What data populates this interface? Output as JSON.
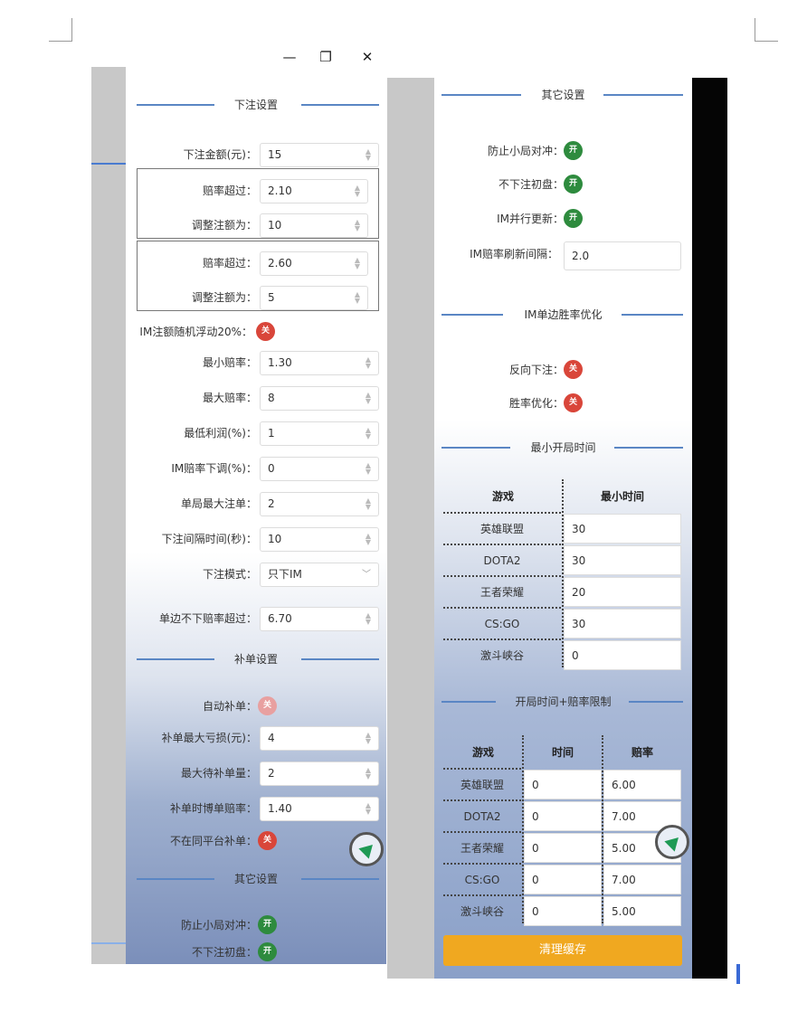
{
  "window_controls": {
    "minimize": "—",
    "restore": "❐",
    "close": "✕"
  },
  "left": {
    "bet_settings": {
      "title": "下注设置",
      "bet_amount": {
        "label": "下注金额(元)：",
        "value": "15"
      },
      "rule1": {
        "odds_label": "赔率超过：",
        "odds_value": "2.10",
        "adjust_label": "调整注额为：",
        "adjust_value": "10"
      },
      "rule2": {
        "odds_label": "赔率超过：",
        "odds_value": "2.60",
        "adjust_label": "调整注额为：",
        "adjust_value": "5"
      },
      "im_random": {
        "label": "IM注额随机浮动20%：",
        "toggle": "关"
      },
      "min_odds": {
        "label": "最小赔率：",
        "value": "1.30"
      },
      "max_odds": {
        "label": "最大赔率：",
        "value": "8"
      },
      "min_profit": {
        "label": "最低利润(%)：",
        "value": "1"
      },
      "im_odds_down": {
        "label": "IM赔率下调(%)：",
        "value": "0"
      },
      "max_per_game": {
        "label": "单局最大注单：",
        "value": "2"
      },
      "bet_interval": {
        "label": "下注间隔时间(秒)：",
        "value": "10"
      },
      "bet_mode": {
        "label": "下注模式：",
        "value": "只下IM"
      },
      "one_side_limit": {
        "label": "单边不下赔率超过：",
        "value": "6.70"
      }
    },
    "supplement": {
      "title": "补单设置",
      "auto": {
        "label": "自动补单：",
        "toggle": "关"
      },
      "max_loss": {
        "label": "补单最大亏损(元)：",
        "value": "4"
      },
      "max_pending": {
        "label": "最大待补单量：",
        "value": "2"
      },
      "bet_odds": {
        "label": "补单时博单赔率：",
        "value": "1.40"
      },
      "not_same_platform": {
        "label": "不在同平台补单：",
        "toggle": "关"
      }
    },
    "other": {
      "title": "其它设置",
      "anti_small": {
        "label": "防止小局对冲：",
        "toggle": "开"
      },
      "no_initial": {
        "label": "不下注初盘：",
        "toggle": "开"
      }
    }
  },
  "right": {
    "other": {
      "title": "其它设置",
      "anti_small": {
        "label": "防止小局对冲：",
        "toggle": "开"
      },
      "no_initial": {
        "label": "不下注初盘：",
        "toggle": "开"
      },
      "im_parallel": {
        "label": "IM并行更新：",
        "toggle": "开"
      },
      "im_refresh": {
        "label": "IM赔率刷新间隔：",
        "value": "2.0"
      }
    },
    "im_opt": {
      "title": "IM单边胜率优化",
      "reverse": {
        "label": "反向下注：",
        "toggle": "关"
      },
      "win_opt": {
        "label": "胜率优化：",
        "toggle": "关"
      }
    },
    "min_time": {
      "title": "最小开局时间",
      "headers": [
        "游戏",
        "最小时间"
      ],
      "rows": [
        {
          "game": "英雄联盟",
          "time": "30"
        },
        {
          "game": "DOTA2",
          "time": "30"
        },
        {
          "game": "王者荣耀",
          "time": "20"
        },
        {
          "game": "CS:GO",
          "time": "30"
        },
        {
          "game": "激斗峡谷",
          "time": "0"
        }
      ]
    },
    "time_odds": {
      "title": "开局时间+赔率限制",
      "headers": [
        "游戏",
        "时间",
        "赔率"
      ],
      "rows": [
        {
          "game": "英雄联盟",
          "time": "0",
          "odds": "6.00"
        },
        {
          "game": "DOTA2",
          "time": "0",
          "odds": "7.00"
        },
        {
          "game": "王者荣耀",
          "time": "0",
          "odds": "5.00"
        },
        {
          "game": "CS:GO",
          "time": "0",
          "odds": "7.00"
        },
        {
          "game": "激斗峡谷",
          "time": "0",
          "odds": "5.00"
        }
      ]
    },
    "clear_cache": "清理缓存"
  },
  "colors": {
    "toggle_on": "#2e8b3e",
    "toggle_off": "#d9463a",
    "button": "#f0a820",
    "accent_line": "#5a86c4"
  }
}
